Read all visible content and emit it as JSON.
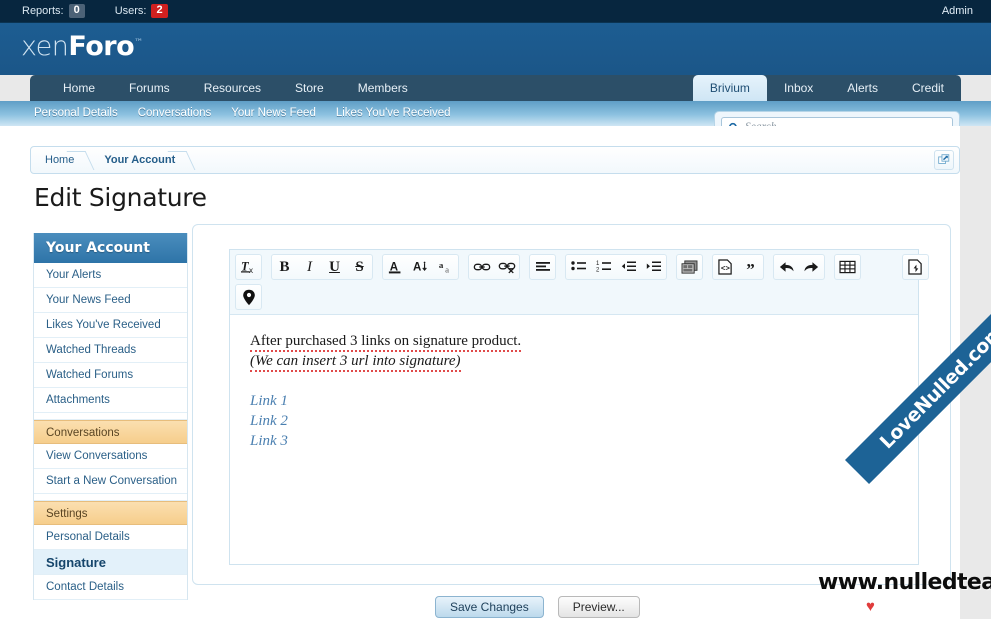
{
  "adminbar": {
    "reports_label": "Reports:",
    "reports_count": "0",
    "users_label": "Users:",
    "users_count": "2",
    "admin_link": "Admin"
  },
  "brand": {
    "logo_thin": "xen",
    "logo_bold": "Foro",
    "logo_tm": "™"
  },
  "nav": {
    "primary": [
      {
        "label": "Home",
        "active": false
      },
      {
        "label": "Forums",
        "active": false
      },
      {
        "label": "Resources",
        "active": false
      },
      {
        "label": "Store",
        "active": false
      },
      {
        "label": "Members",
        "active": false
      }
    ],
    "right": [
      {
        "label": "Brivium",
        "active": true
      },
      {
        "label": "Inbox",
        "active": false
      },
      {
        "label": "Alerts",
        "active": false
      },
      {
        "label": "Credit",
        "active": false
      }
    ],
    "secondary": [
      {
        "label": "Personal Details"
      },
      {
        "label": "Conversations"
      },
      {
        "label": "Your News Feed"
      },
      {
        "label": "Likes You've Received"
      }
    ]
  },
  "search": {
    "placeholder": "Search...",
    "icon": "search-icon"
  },
  "breadcrumb": {
    "items": [
      {
        "label": "Home"
      },
      {
        "label": "Your Account"
      }
    ],
    "expand_icon": "open-in-new-window-icon"
  },
  "page": {
    "title": "Edit Signature"
  },
  "sidebar": {
    "header": "Your Account",
    "items": [
      {
        "label": "Your Alerts",
        "type": "item"
      },
      {
        "label": "Your News Feed",
        "type": "item"
      },
      {
        "label": "Likes You've Received",
        "type": "item"
      },
      {
        "label": "Watched Threads",
        "type": "item"
      },
      {
        "label": "Watched Forums",
        "type": "item"
      },
      {
        "label": "Attachments",
        "type": "item"
      },
      {
        "label": "Conversations",
        "type": "section"
      },
      {
        "label": "View Conversations",
        "type": "item"
      },
      {
        "label": "Start a New Conversation",
        "type": "item"
      },
      {
        "label": "Settings",
        "type": "section"
      },
      {
        "label": "Personal Details",
        "type": "item"
      },
      {
        "label": "Signature",
        "type": "item",
        "selected": true
      },
      {
        "label": "Contact Details",
        "type": "item"
      }
    ]
  },
  "editor": {
    "toolbar_rows": [
      {
        "groups": [
          {
            "buttons": [
              {
                "name": "remove-formatting-icon",
                "title": "Remove Formatting"
              }
            ]
          },
          {
            "buttons": [
              {
                "name": "bold-icon",
                "title": "Bold"
              },
              {
                "name": "italic-icon",
                "title": "Italic"
              },
              {
                "name": "underline-icon",
                "title": "Underline"
              },
              {
                "name": "strikethrough-icon",
                "title": "Strike Through"
              }
            ]
          },
          {
            "buttons": [
              {
                "name": "text-color-icon",
                "title": "Text Color"
              },
              {
                "name": "font-size-icon",
                "title": "Font Size"
              },
              {
                "name": "font-family-icon",
                "title": "Font Family"
              }
            ]
          },
          {
            "buttons": [
              {
                "name": "insert-link-icon",
                "title": "Insert Link"
              },
              {
                "name": "unlink-icon",
                "title": "Unlink"
              }
            ]
          },
          {
            "buttons": [
              {
                "name": "align-icon",
                "title": "Alignment"
              }
            ]
          },
          {
            "buttons": [
              {
                "name": "bullet-list-icon",
                "title": "Bullet List"
              },
              {
                "name": "numbered-list-icon",
                "title": "Numbered List"
              },
              {
                "name": "outdent-icon",
                "title": "Outdent"
              },
              {
                "name": "indent-icon",
                "title": "Indent"
              }
            ]
          },
          {
            "buttons": [
              {
                "name": "insert-image-icon",
                "title": "Insert Image"
              }
            ]
          },
          {
            "buttons": [
              {
                "name": "code-icon",
                "title": "Code"
              },
              {
                "name": "quote-icon",
                "title": "Quote"
              }
            ]
          },
          {
            "buttons": [
              {
                "name": "undo-icon",
                "title": "Undo"
              },
              {
                "name": "redo-icon",
                "title": "Redo"
              }
            ]
          },
          {
            "buttons": [
              {
                "name": "insert-table-icon",
                "title": "Insert Table"
              }
            ]
          },
          {
            "buttons": [
              {
                "name": "draft-tool-icon",
                "title": "Draft"
              }
            ]
          }
        ]
      },
      {
        "groups": [
          {
            "buttons": [
              {
                "name": "map-pin-icon",
                "title": "Insert Location"
              }
            ]
          }
        ]
      }
    ],
    "content": {
      "line1": "After purchased 3 links on signature product.",
      "line2": "(We can insert 3 url into signature)",
      "links": [
        "Link 1",
        "Link 2",
        "Link 3"
      ]
    }
  },
  "footer": {
    "save_label": "Save Changes",
    "preview_label": "Preview..."
  },
  "watermarks": {
    "url_text": "www.nulledteam.com",
    "ribbon_text": "LoveNulled.com",
    "heart_glyph": "♥"
  },
  "colors": {
    "header_blue": "#1b5688",
    "nav_dark": "#2c4f68",
    "accent_orange": "#f6ce8c",
    "sidebar_head": "#2e74a8",
    "badge_red": "#d02020",
    "link_blue": "#2a5f87",
    "ribbon_blue": "#1d6396"
  }
}
